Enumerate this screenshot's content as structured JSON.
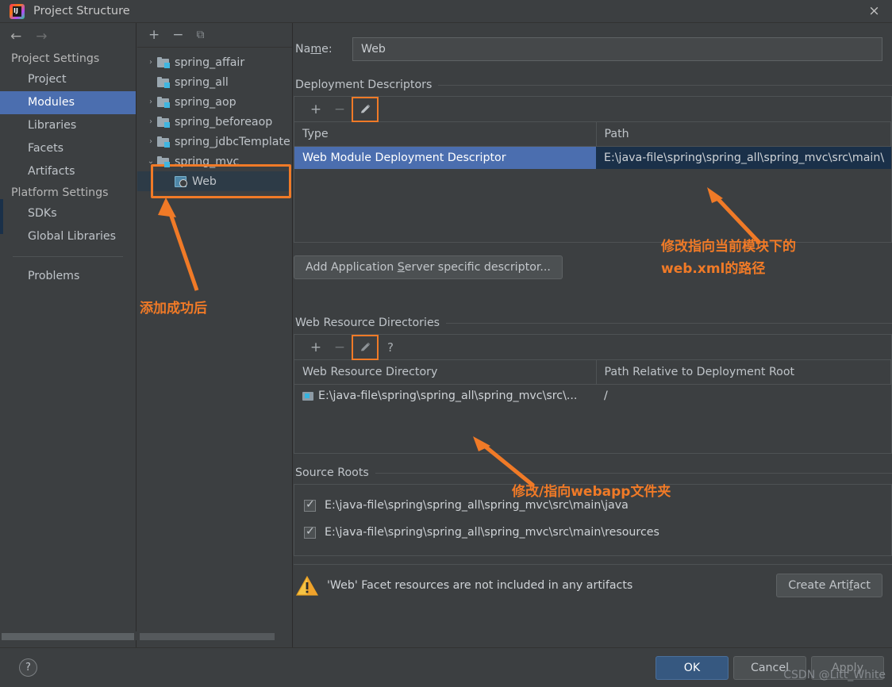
{
  "window": {
    "title": "Project Structure",
    "logo_text": "IJ",
    "close_icon": "×"
  },
  "sidebar": {
    "back_icon": "←",
    "forward_icon": "→",
    "groups": [
      {
        "label": "Project Settings",
        "items": [
          {
            "label": "Project",
            "selected": false
          },
          {
            "label": "Modules",
            "selected": true
          },
          {
            "label": "Libraries",
            "selected": false
          },
          {
            "label": "Facets",
            "selected": false
          },
          {
            "label": "Artifacts",
            "selected": false
          }
        ]
      },
      {
        "label": "Platform Settings",
        "items": [
          {
            "label": "SDKs",
            "selected": false
          },
          {
            "label": "Global Libraries",
            "selected": false
          }
        ]
      }
    ],
    "problems": "Problems"
  },
  "modules_panel": {
    "toolbar": {
      "add": "+",
      "remove": "−",
      "copy": "⧉"
    },
    "tree": [
      {
        "label": "spring_affair",
        "twisty": "›",
        "icon": "folder-module-icon",
        "indent": 0,
        "selected": false
      },
      {
        "label": "spring_all",
        "twisty": "",
        "icon": "folder-module-icon",
        "indent": 0,
        "selected": false
      },
      {
        "label": "spring_aop",
        "twisty": "›",
        "icon": "folder-module-icon",
        "indent": 0,
        "selected": false
      },
      {
        "label": "spring_beforeaop",
        "twisty": "›",
        "icon": "folder-module-icon",
        "indent": 0,
        "selected": false
      },
      {
        "label": "spring_jdbcTemplate",
        "twisty": "›",
        "icon": "folder-module-icon",
        "indent": 0,
        "selected": false
      },
      {
        "label": "spring_mvc",
        "twisty": "⌄",
        "icon": "folder-module-icon",
        "indent": 0,
        "selected": false
      },
      {
        "label": "Web",
        "twisty": "",
        "icon": "web-facet-icon",
        "indent": 1,
        "selected": true
      }
    ]
  },
  "main": {
    "name_label_pre": "Na",
    "name_label_accel": "m",
    "name_label_post": "e:",
    "name_value": "Web",
    "deployment": {
      "section_title": "Deployment Descriptors",
      "toolbar": {
        "add": "+",
        "remove": "−",
        "edit": "pencil-icon"
      },
      "columns": [
        "Type",
        "Path"
      ],
      "rows": [
        {
          "type": "Web Module Deployment Descriptor",
          "path": "E:\\java-file\\spring\\spring_all\\spring_mvc\\src\\main\\",
          "selected": true
        }
      ],
      "add_descriptor_button_pre": "Add Application ",
      "add_descriptor_button_accel": "S",
      "add_descriptor_button_post": "erver specific descriptor..."
    },
    "web_resources": {
      "section_title": "Web Resource Directories",
      "toolbar": {
        "add": "+",
        "remove": "−",
        "edit": "pencil-icon",
        "help": "?"
      },
      "columns": [
        "Web Resource Directory",
        "Path Relative to Deployment Root"
      ],
      "rows": [
        {
          "directory": "E:\\java-file\\spring\\spring_all\\spring_mvc\\src\\...",
          "relative": "/"
        }
      ]
    },
    "source_roots": {
      "section_title": "Source Roots",
      "rows": [
        {
          "path": "E:\\java-file\\spring\\spring_all\\spring_mvc\\src\\main\\java",
          "checked": true
        },
        {
          "path": "E:\\java-file\\spring\\spring_all\\spring_mvc\\src\\main\\resources",
          "checked": true
        }
      ]
    },
    "warning": {
      "icon": "warning-icon",
      "text": "'Web' Facet resources are not included in any artifacts",
      "action_pre": "Create Arti",
      "action_accel": "f",
      "action_post": "act"
    }
  },
  "bottom_bar": {
    "help": "?",
    "ok": "OK",
    "cancel": "Cancel",
    "apply": "Apply"
  },
  "annotations": {
    "module_added": "添加成功后",
    "descriptor_line1": "修改指向当前模块下的",
    "descriptor_line2_bold": "web.xml",
    "descriptor_line2_rest": "的路径",
    "webapp_pre": "修改/指向",
    "webapp_bold": "webapp",
    "webapp_post": "文件夹",
    "color": "#f07a27"
  },
  "watermark": "CSDN @Litt_White"
}
